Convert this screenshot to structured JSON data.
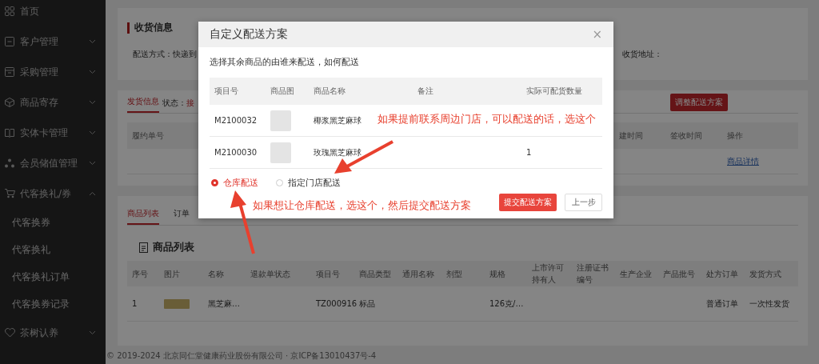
{
  "sidebar": {
    "items": [
      {
        "label": "首页",
        "kind": "link"
      },
      {
        "label": "客户管理",
        "kind": "group",
        "expanded": false
      },
      {
        "label": "采购管理",
        "kind": "group",
        "expanded": false
      },
      {
        "label": "商品寄存",
        "kind": "group",
        "expanded": false
      },
      {
        "label": "实体卡管理",
        "kind": "group",
        "expanded": false
      },
      {
        "label": "会员储值管理",
        "kind": "group",
        "expanded": false
      },
      {
        "label": "代客换礼/券",
        "kind": "group",
        "expanded": true,
        "children": [
          {
            "label": "代客换券"
          },
          {
            "label": "代客换礼"
          },
          {
            "label": "代客换礼订单"
          },
          {
            "label": "代客换券记录"
          }
        ]
      },
      {
        "label": "茶树认养",
        "kind": "group",
        "expanded": false
      }
    ]
  },
  "receipt_info": {
    "title": "收货信息",
    "delivery_method": "配送方式：快递到",
    "address_label": "收货地址："
  },
  "shipping": {
    "tabs": [
      {
        "label": "发货信息",
        "selected": true
      }
    ],
    "status_label": "状态：",
    "status_value": "接",
    "adjust_button": "调整配送方案",
    "columns": [
      "履约单号",
      "建时间",
      "签收时间",
      "操作"
    ],
    "row_action": "商品详情"
  },
  "product_tabs": [
    {
      "label": "商品列表",
      "selected": true
    },
    {
      "label": "订单",
      "selected": false
    }
  ],
  "product_list": {
    "title": "商品列表",
    "columns": [
      "序号",
      "图片",
      "名称",
      "退款单状态",
      "项目号",
      "商品类型",
      "通用名称",
      "剂型",
      "规格",
      "上市许可持有人",
      "注册证书编号",
      "生产企业",
      "产品批号",
      "处方订单",
      "发货方式"
    ],
    "rows": [
      {
        "index": "1",
        "name": "黑芝麻…",
        "item_no": "TZ000916",
        "type": "标品",
        "spec": "126克/…",
        "prescription": "普通订单",
        "shipping": "一次性发货"
      }
    ]
  },
  "footer": "© 2019-2024 北京同仁堂健康药业股份有限公司 · 京ICP备13010437号-4",
  "dialog": {
    "title": "自定义配送方案",
    "close": "×",
    "subtitle": "选择其余商品的由谁来配送，如何配送",
    "columns": [
      "项目号",
      "商品图",
      "商品名称",
      "备注",
      "实际可配货数量"
    ],
    "rows": [
      {
        "item_no": "M2100032",
        "name": "椰浆黑芝麻球"
      },
      {
        "item_no": "M2100030",
        "name": "玫瑰黑芝麻球",
        "quantity": "1"
      }
    ],
    "options": [
      {
        "label": "仓库配送",
        "selected": true
      },
      {
        "label": "指定门店配送",
        "selected": false
      }
    ],
    "submit_button": "提交配送方案",
    "back_button": "上一步"
  },
  "annotations": [
    {
      "text": "如果提前联系周边门店，可以配送的话，选这个"
    },
    {
      "text": "如果想让仓库配送，选这个，然后提交配送方案"
    }
  ]
}
